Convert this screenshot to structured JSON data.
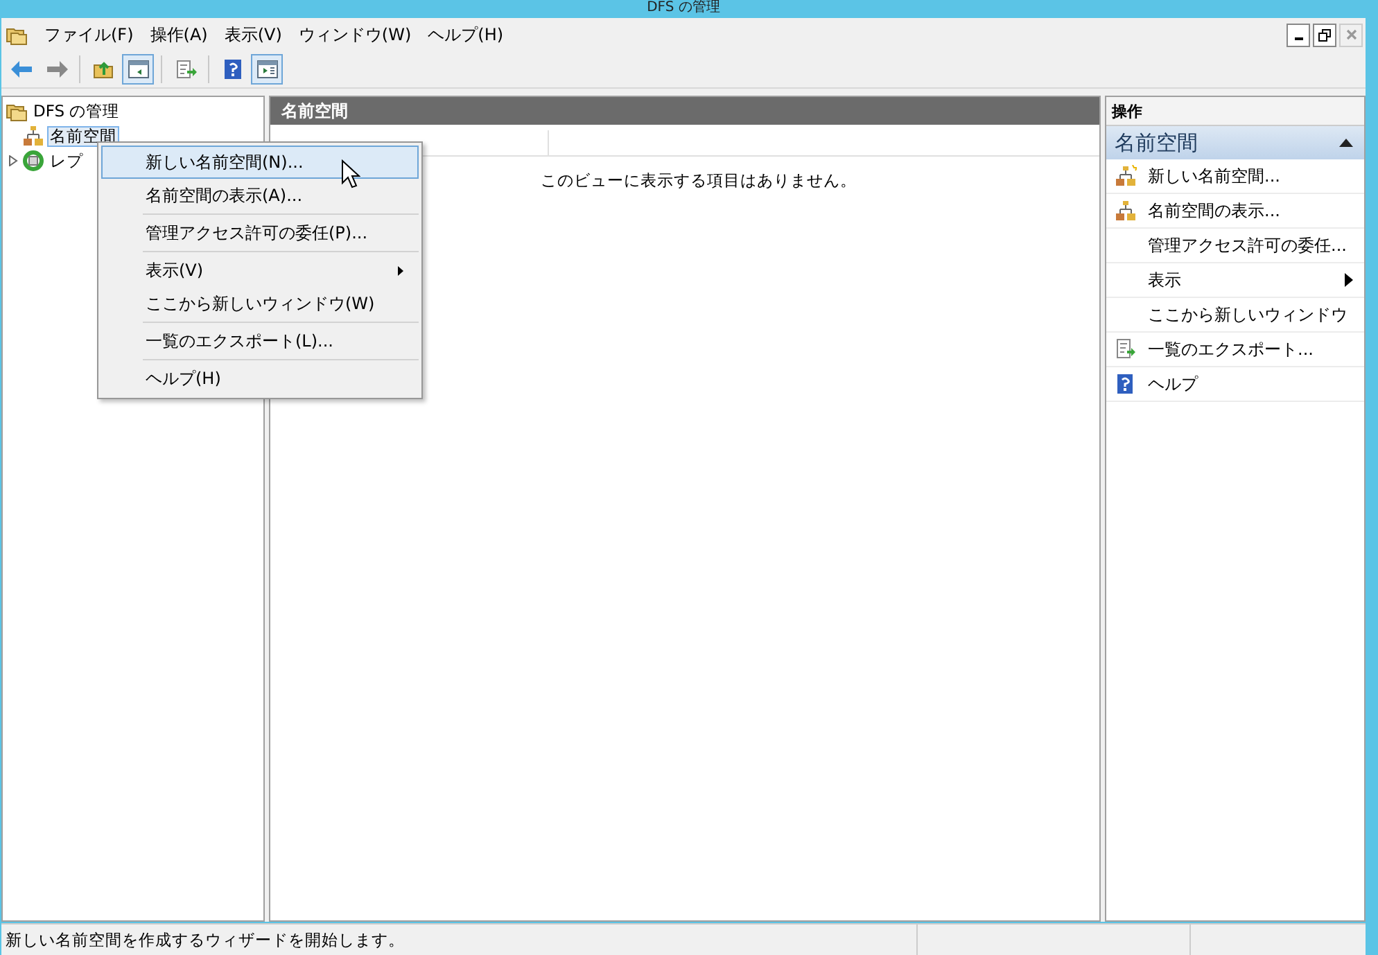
{
  "window": {
    "title": "DFS の管理"
  },
  "menu_bar": [
    "ファイル(F)",
    "操作(A)",
    "表示(V)",
    "ウィンドウ(W)",
    "ヘルプ(H)"
  ],
  "toolbar": [
    {
      "kind": "back"
    },
    {
      "kind": "forward"
    },
    {
      "kind": "separator"
    },
    {
      "kind": "up"
    },
    {
      "kind": "pane",
      "selected": true
    },
    {
      "kind": "separator"
    },
    {
      "kind": "export"
    },
    {
      "kind": "separator"
    },
    {
      "kind": "help"
    },
    {
      "kind": "pane2",
      "selected": true
    }
  ],
  "tree": [
    {
      "label": "DFS の管理",
      "kind": "root",
      "children": [
        {
          "label": "名前空間",
          "kind": "namespace",
          "selected": true
        },
        {
          "label": "レプ",
          "kind": "replication",
          "expanded": false
        }
      ]
    }
  ],
  "context_menu": [
    {
      "kind": "item",
      "label": "新しい名前空間(N)...",
      "selected": true,
      "submenu": false
    },
    {
      "kind": "item",
      "label": "名前空間の表示(A)...",
      "selected": false,
      "submenu": false
    },
    {
      "kind": "separator"
    },
    {
      "kind": "item",
      "label": "管理アクセス許可の委任(P)...",
      "selected": false,
      "submenu": false
    },
    {
      "kind": "separator"
    },
    {
      "kind": "item",
      "label": "表示(V)",
      "selected": false,
      "submenu": true
    },
    {
      "kind": "item",
      "label": "ここから新しいウィンドウ(W)",
      "selected": false,
      "submenu": false
    },
    {
      "kind": "separator"
    },
    {
      "kind": "item",
      "label": "一覧のエクスポート(L)...",
      "selected": false,
      "submenu": false
    },
    {
      "kind": "separator"
    },
    {
      "kind": "item",
      "label": "ヘルプ(H)",
      "selected": false,
      "submenu": false
    }
  ],
  "content": {
    "title": "名前空間",
    "empty_message": "このビューに表示する項目はありません。"
  },
  "actions": {
    "title": "操作",
    "section": "名前空間",
    "items": [
      {
        "label": "新しい名前空間...",
        "kind": "new-namespace",
        "submenu": false
      },
      {
        "label": "名前空間の表示...",
        "kind": "namespace",
        "submenu": false
      },
      {
        "label": "管理アクセス許可の委任...",
        "kind": "plain",
        "submenu": false
      },
      {
        "label": "表示",
        "kind": "plain",
        "submenu": true
      },
      {
        "label": "ここから新しいウィンドウ",
        "kind": "plain",
        "submenu": false
      },
      {
        "label": "一覧のエクスポート...",
        "kind": "export",
        "submenu": false
      },
      {
        "label": "ヘルプ",
        "kind": "help",
        "submenu": false
      }
    ]
  },
  "status_bar": "新しい名前空間を作成するウィザードを開始します。"
}
